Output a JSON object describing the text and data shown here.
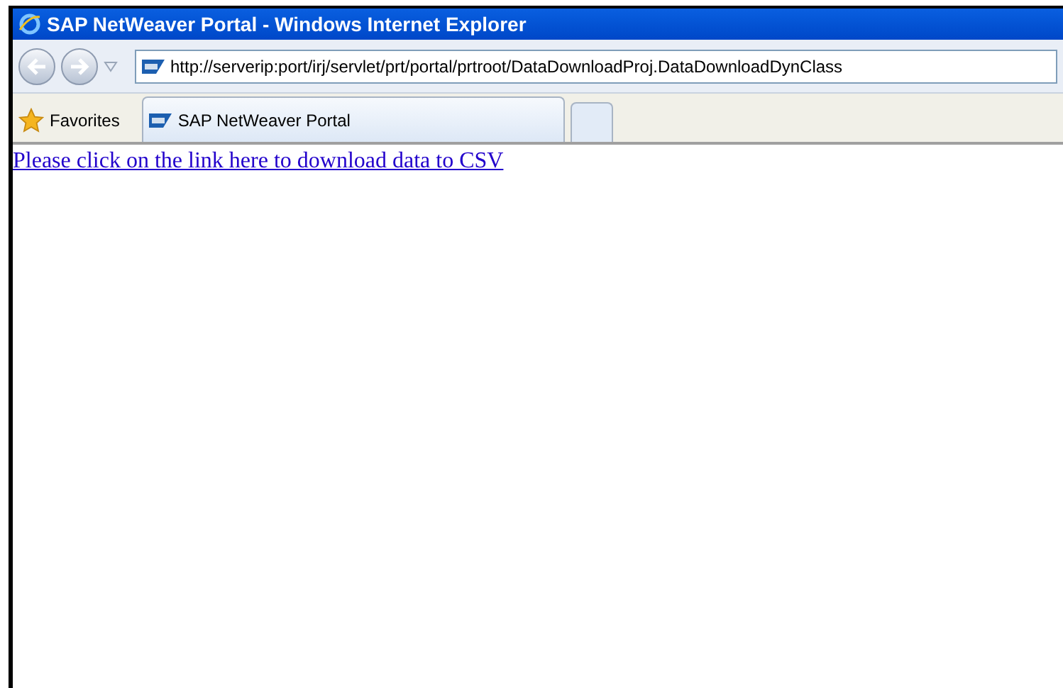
{
  "window": {
    "title": "SAP NetWeaver Portal - Windows Internet Explorer"
  },
  "address_bar": {
    "url": "http://serverip:port/irj/servlet/prt/portal/prtroot/DataDownloadProj.DataDownloadDynClass"
  },
  "favorites": {
    "label": "Favorites"
  },
  "tabs": [
    {
      "label": "SAP NetWeaver Portal",
      "selected": true
    }
  ],
  "page": {
    "link": "Please click on the link here to download data to CSV"
  }
}
